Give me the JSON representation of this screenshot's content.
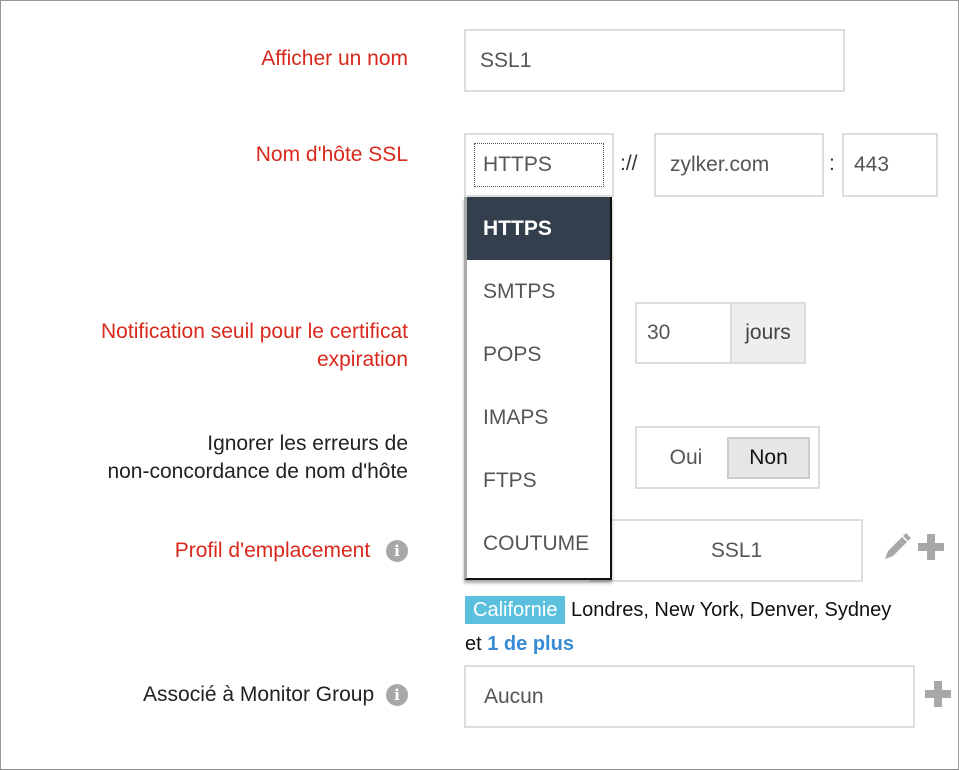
{
  "form": {
    "display_name": {
      "label": "Afficher un nom",
      "value": "SSL1"
    },
    "ssl_host": {
      "label": "Nom d'hôte SSL",
      "protocol": "HTTPS",
      "scheme_separator": "://",
      "host": "zylker.com",
      "port_separator": ":",
      "port": "443"
    },
    "protocol_dropdown": {
      "options": [
        "HTTPS",
        "SMTPS",
        "POPS",
        "IMAPS",
        "FTPS",
        "COUTUME"
      ],
      "selected": "HTTPS"
    },
    "expiry_threshold": {
      "label_line1": "Notification seuil pour le certificat",
      "label_line2": "expiration",
      "value": "30",
      "unit": "jours"
    },
    "ignore_mismatch": {
      "label_line1": "Ignorer les erreurs de",
      "label_line2": "non-concordance de nom d'hôte",
      "option_yes": "Oui",
      "option_no": "Non",
      "selected": "Non"
    },
    "location_profile": {
      "label": "Profil d'emplacement",
      "value": "SSL1",
      "primary_location": "Californie",
      "other_locations": "Londres, New York, Denver, Sydney",
      "and_text": "et",
      "more_link": "1 de plus"
    },
    "monitor_group": {
      "label": "Associé à Monitor Group",
      "value": "Aucun"
    }
  },
  "icons": {
    "info": "i"
  },
  "colors": {
    "required_label": "#d9281c",
    "dropdown_selected_bg": "#333f4c",
    "location_tag": "#5bc0de",
    "link": "#3a8bd4"
  }
}
